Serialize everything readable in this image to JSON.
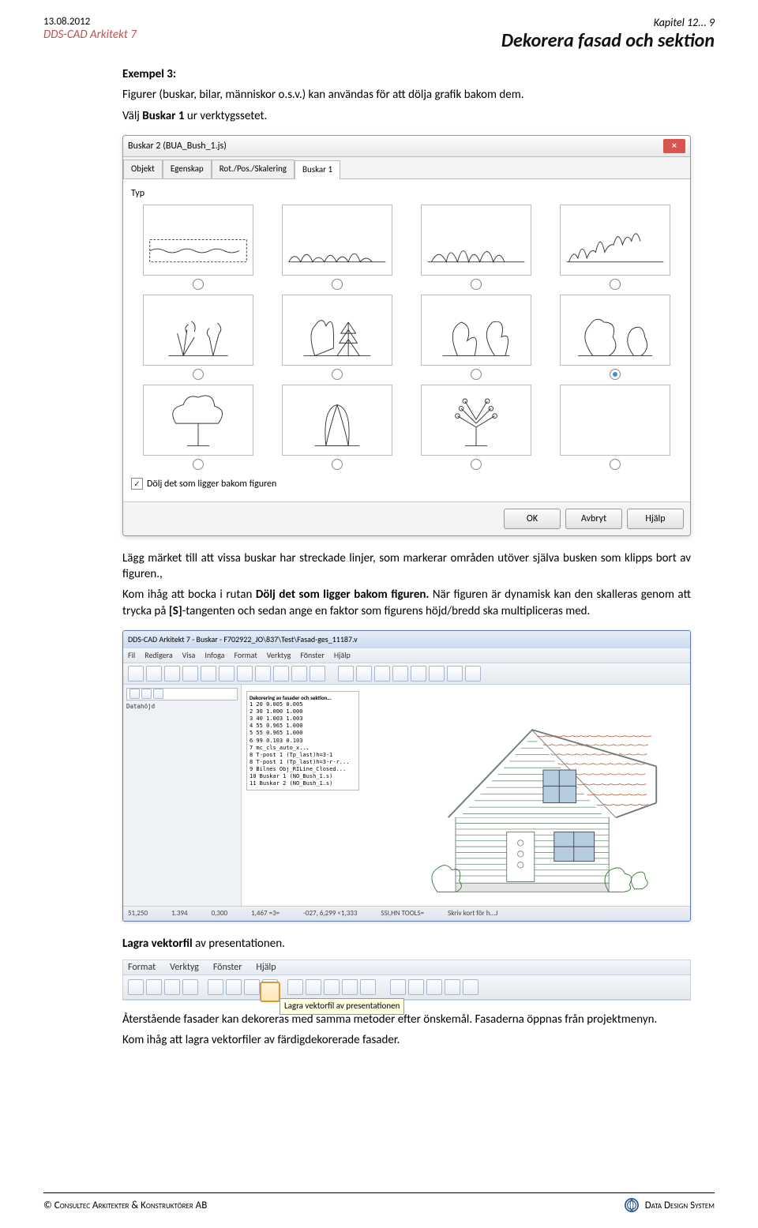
{
  "header": {
    "date": "13.08.2012",
    "sub": "DDS-CAD Arkitekt 7",
    "chapter": "Kapitel 12... 9",
    "title": "Dekorera fasad och sektion"
  },
  "example": {
    "label": "Exempel 3:",
    "line1": "Figurer (buskar, bilar, människor o.s.v.) kan användas för att dölja grafik bakom dem.",
    "line2_pre": "Välj ",
    "line2_bold": "Buskar 1",
    "line2_post": " ur verktygssetet."
  },
  "dialog": {
    "title": "Buskar 2 (BUA_Bush_1.js)",
    "tabs": [
      "Objekt",
      "Egenskap",
      "Rot./Pos./Skalering",
      "Buskar 1"
    ],
    "activeTab": 3,
    "typ": "Typ",
    "checkbox_label": "Dölj det som ligger bakom figuren",
    "checkbox_checked": true,
    "selectedRadio": 7,
    "buttons": {
      "ok": "OK",
      "cancel": "Avbryt",
      "help": "Hjälp"
    }
  },
  "mid_para": {
    "p1": "Lägg märket till att vissa buskar har streckade linjer, som markerar områden utöver själva busken som klipps bort av figuren.,",
    "p2_pre": "Kom ihåg att bocka i rutan ",
    "p2_bold": "Dölj det som ligger bakom figuren.",
    "p2_post": " När figuren är dynamisk kan den skalleras genom att trycka på ",
    "p2_key": "[S]",
    "p2_tail": "-tangenten och sedan ange en faktor som figurens höjd/bredd ska multipliceras med."
  },
  "cadwin": {
    "title": "DDS-CAD Arkitekt 7 - Buskar - F702922_JO\\837\\Test\\Fasad-ges_11187.v",
    "menus": [
      "Fil",
      "Redigera",
      "Visa",
      "Infoga",
      "Format",
      "Verktyg",
      "Fönster",
      "Hjälp"
    ],
    "legend_title": "Dekorering av fasader och sektion...",
    "legend_rows": [
      "1   20   0.005   0.005",
      "2   30   1.000   1.000",
      "3   40   1.003   1.003",
      "4   55   0.965   1.000",
      "5   55   0.965   1.000",
      "6   99   0.103   0.103",
      "7   mc_cls_auto_x...",
      "8   T-post 1 (Tp_last)h=3-1",
      "8   T-post 1 (Tp_last)h=3-r-r...",
      "9   Bilnes Obj_RILine_Closed...",
      "10  Buskar 1 (NO_Bush_1.s)",
      "11  Buskar 2 (NO_Bush_1.s)"
    ],
    "status": [
      "51,250",
      "1.394",
      "0,300",
      "1,467 =3=",
      "-027, 6,299 <1,333",
      "SSI,HN TOOLS=",
      "Skriv kort för h...J"
    ],
    "left_tree_label": "Datahöjd",
    "left_tree_items": [
      "",
      "",
      "",
      ""
    ]
  },
  "lagra_line_pre": "Lagra vektorfil",
  "lagra_line_post": " av presentationen.",
  "toolbar_strip": {
    "menus": [
      "Format",
      "Verktyg",
      "Fönster",
      "Hjälp"
    ],
    "tooltip": "Lagra vektorfil av presentationen"
  },
  "tail": {
    "p1": "Återstående fasader kan dekoreras med samma metoder efter önskemål. Fasaderna öppnas från projektmenyn.",
    "p2": "Kom ihåg att lagra vektorfiler av färdigdekorerade fasader."
  },
  "footer": {
    "left": "©   Consultec Arkitekter & Konstruktörer AB",
    "right": "Data Design System"
  }
}
